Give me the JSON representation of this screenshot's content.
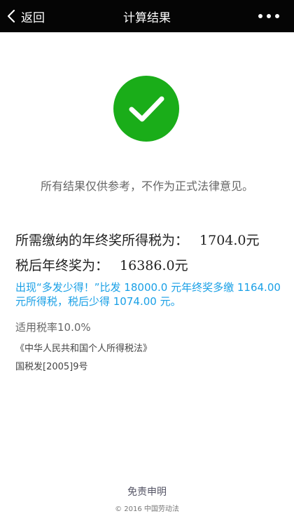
{
  "nav": {
    "back_label": "返回",
    "title": "计算结果"
  },
  "icons": {
    "back": "chevron-left-icon",
    "more": "more-dots-icon",
    "success": "check-circle-icon"
  },
  "colors": {
    "success_green": "#1aad19",
    "info_blue": "#1aa0e6",
    "nav_bg": "#050505"
  },
  "notice": "所有结果仅供参考，不作为正式法律意见。",
  "results": {
    "tax_label": "所需缴纳的年终奖所得税为：",
    "tax_value": "1704.0元",
    "after_tax_label": "税后年终奖为：",
    "after_tax_value": "16386.0元"
  },
  "blue_note": "出现“多发少得！”比发 18000.0 元年终奖多缴 1164.00元所得税，税后少得 1074.00 元。",
  "rate": "适用税率10.0%",
  "law": "《中华人民共和国个人所得税法》",
  "doc_ref": "国税发[2005]9号",
  "footer": {
    "disclaimer": "免责申明",
    "copyright": "© 2016  中国劳动法"
  }
}
